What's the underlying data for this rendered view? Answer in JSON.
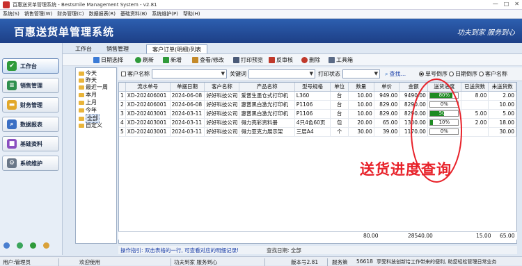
{
  "window": {
    "title": "百惠送货单管理系统 - Bestsmile Management System - v2.81",
    "controls": [
      "—",
      "□",
      "✕"
    ]
  },
  "menu": [
    "系统(S)",
    "销售管理(W)",
    "财务管理(C)",
    "数据报表(R)",
    "基础资料(B)",
    "系统维护(P)",
    "帮助(H)"
  ],
  "banner": {
    "title": "百惠送货单管理系统",
    "slogan": "功夫到家 服务到心"
  },
  "sidebar": {
    "items": [
      {
        "label": "工作台",
        "icon": "check-icon",
        "color": "#2f9a3a",
        "active": true
      },
      {
        "label": "销售管理",
        "icon": "sales-ledger-icon",
        "color": "#2f8f4e",
        "active": false
      },
      {
        "label": "财务管理",
        "icon": "folder-icon",
        "color": "#e2a82a",
        "active": false
      },
      {
        "label": "数据报表",
        "icon": "search-report-icon",
        "color": "#3b6fc4",
        "active": false
      },
      {
        "label": "基础资料",
        "icon": "data-blocks-icon",
        "color": "#8a4fc0",
        "active": false
      },
      {
        "label": "系统维护",
        "icon": "gear-icon",
        "color": "#6a7788",
        "active": false
      }
    ]
  },
  "tabs": [
    {
      "label": "工作台",
      "active": false
    },
    {
      "label": "销售管理",
      "active": false
    },
    {
      "label": "客户订单(明细)列表",
      "active": true
    }
  ],
  "toolbar": {
    "items": [
      {
        "label": "日期选择",
        "icon": "calendar-icon",
        "color": "#3b7bd6"
      },
      {
        "label": "刷新",
        "icon": "refresh-icon",
        "color": "#2f9a3a"
      },
      {
        "label": "新增",
        "icon": "add-icon",
        "color": "#2f9a3a"
      },
      {
        "label": "查看/修改",
        "icon": "edit-icon",
        "color": "#c48a2a"
      },
      {
        "label": "打印预览",
        "icon": "print-preview-icon",
        "color": "#4a5a78"
      },
      {
        "label": "反审核",
        "icon": "unaudit-icon",
        "color": "#c0392b"
      },
      {
        "label": "删除",
        "icon": "delete-icon",
        "color": "#c0392b"
      },
      {
        "label": "工具箱",
        "icon": "toolbox-icon",
        "color": "#5a6a85"
      }
    ]
  },
  "tree": {
    "items": [
      "今天",
      "昨天",
      "最近一周",
      "本月",
      "上月",
      "今年",
      "全部",
      "自定义"
    ],
    "selected": "全部"
  },
  "filters": {
    "customer_label": "客户名称",
    "keyword_label": "关键词",
    "print_status_label": "打印状态",
    "search_label": "查找...",
    "radios": [
      {
        "label": "单号倒序",
        "checked": true
      },
      {
        "label": "日期倒序",
        "checked": false
      },
      {
        "label": "客户名称",
        "checked": false
      }
    ]
  },
  "grid": {
    "columns": [
      "流水单号",
      "单据日期",
      "客户名称",
      "产品名称",
      "型号规格",
      "单位",
      "数量",
      "单价",
      "金额",
      "送货进度",
      "已送货数",
      "未送货数"
    ],
    "rows": [
      {
        "idx": "1",
        "no": "XD-202406001",
        "date": "2024-06-08",
        "customer": "好好科技公司",
        "product": "爱普生墨仓式打印机",
        "spec": "L360",
        "unit": "台",
        "qty": "10.00",
        "price": "949.00",
        "amount": "9490.00",
        "progress": 0.8,
        "progress_label": "80%",
        "delivered": "8.00",
        "remaining": "2.00"
      },
      {
        "idx": "2",
        "no": "XD-202406001",
        "date": "2024-06-08",
        "customer": "好好科技公司",
        "product": "惠普黑白激光打印机",
        "spec": "P1106",
        "unit": "台",
        "qty": "10.00",
        "price": "829.00",
        "amount": "8290.00",
        "progress": 0,
        "progress_label": "0%",
        "delivered": "",
        "remaining": "10.00"
      },
      {
        "idx": "3",
        "no": "XD-202403001",
        "date": "2024-03-11",
        "customer": "好好科技公司",
        "product": "惠普黑白激光打印机",
        "spec": "P1106",
        "unit": "台",
        "qty": "10.00",
        "price": "829.00",
        "amount": "8290.00",
        "progress": 0.5,
        "progress_label": "50%",
        "delivered": "5.00",
        "remaining": "5.00"
      },
      {
        "idx": "4",
        "no": "XD-202403001",
        "date": "2024-03-11",
        "customer": "好好科技公司",
        "product": "得力亮彩资料册",
        "spec": "4只4色60页",
        "unit": "包",
        "qty": "20.00",
        "price": "65.00",
        "amount": "1300.00",
        "progress": 0.1,
        "progress_label": "10%",
        "delivered": "2.00",
        "remaining": "18.00"
      },
      {
        "idx": "5",
        "no": "XD-202403001",
        "date": "2024-03-11",
        "customer": "好好科技公司",
        "product": "得力亚克力展示架",
        "spec": "三层A4",
        "unit": "个",
        "qty": "30.00",
        "price": "39.00",
        "amount": "1170.00",
        "progress": 0,
        "progress_label": "0%",
        "delivered": "",
        "remaining": "30.00"
      }
    ]
  },
  "totals": {
    "qty": "80.00",
    "amount": "28540.00",
    "delivered": "15.00",
    "remaining": "65.00"
  },
  "tipbar": {
    "tip": "操作指引: 双击表格的一行, 可查看对应的明细记录!",
    "result": "查找日期: 全部"
  },
  "statusbar": {
    "user": "用户:管理员",
    "welcome": "欢迎使用",
    "slogan": "功夫到家 服务到心",
    "version": "版本号2.81",
    "service_label": "服务策",
    "service_no": "56618",
    "notice": "享受科技创新给工作带来的便利, 助您轻松管理日常业务"
  },
  "annotation": {
    "text": "送货进度查询",
    "color": "#e8222a"
  }
}
